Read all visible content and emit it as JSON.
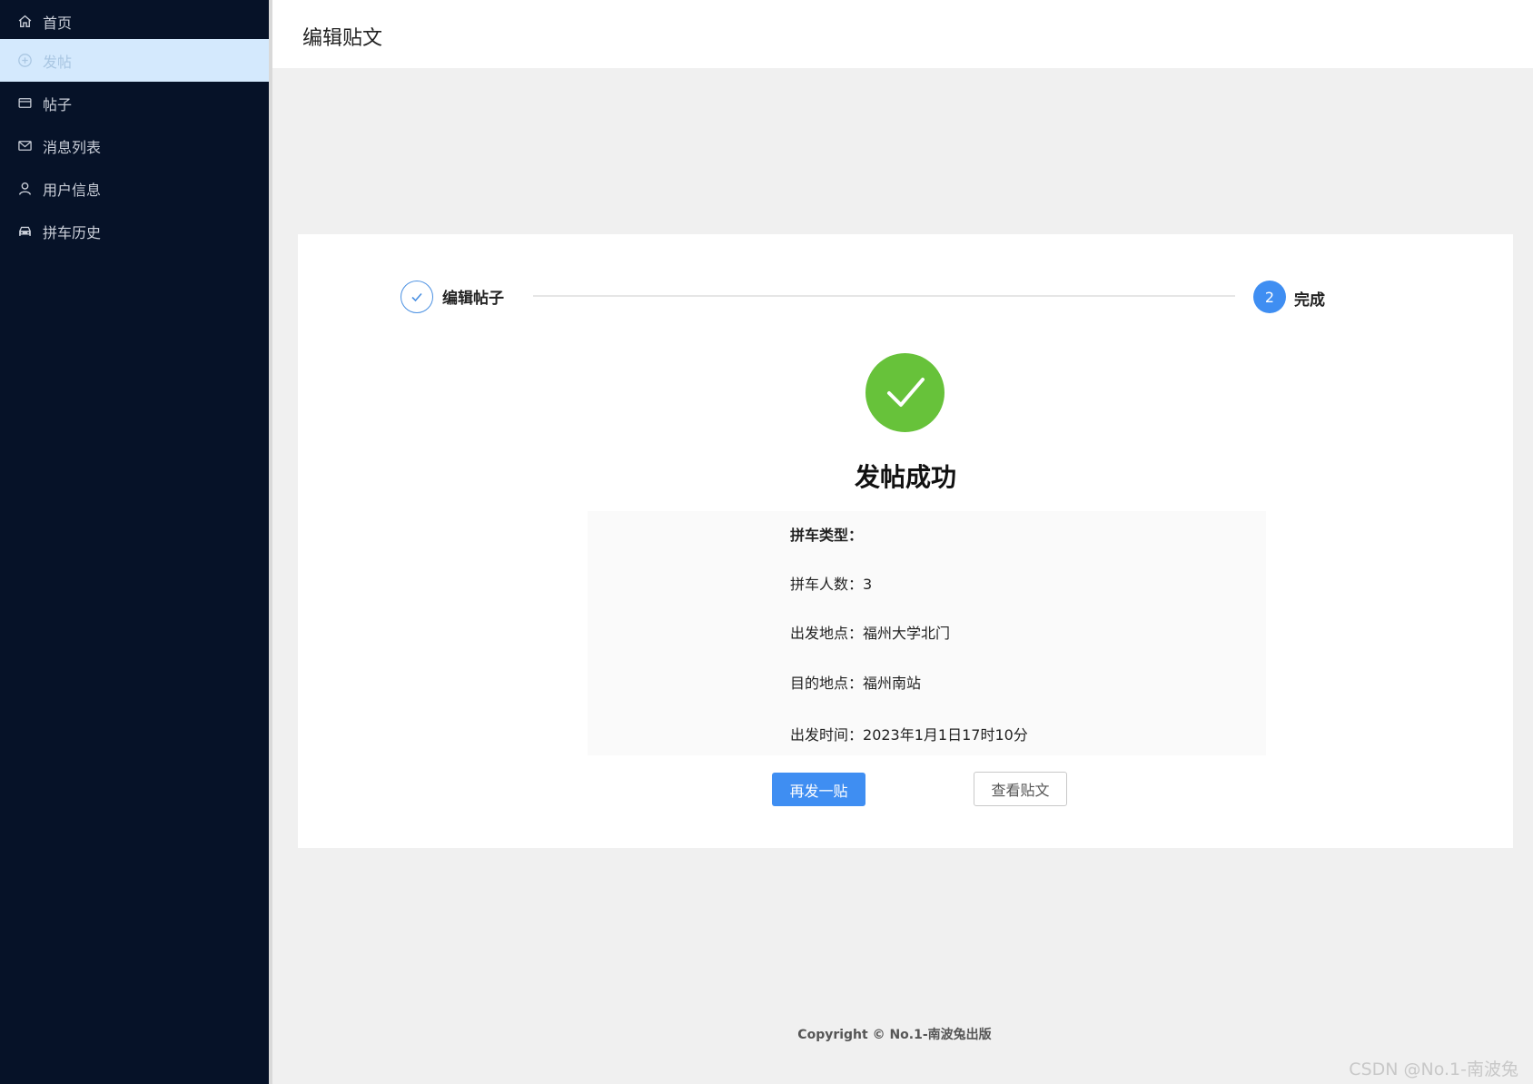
{
  "sidebar": {
    "items": [
      {
        "label": "首页",
        "icon": "home-icon"
      },
      {
        "label": "发帖",
        "icon": "plus-circle-icon",
        "active": true
      },
      {
        "label": "帖子",
        "icon": "card-icon"
      },
      {
        "label": "消息列表",
        "icon": "mail-icon"
      },
      {
        "label": "用户信息",
        "icon": "user-icon"
      },
      {
        "label": "拼车历史",
        "icon": "car-icon"
      }
    ]
  },
  "header": {
    "title": "编辑贴文"
  },
  "steps": [
    {
      "label": "编辑帖子",
      "status": "done"
    },
    {
      "label": "完成",
      "number": "2",
      "status": "active"
    }
  ],
  "result": {
    "title": "发帖成功",
    "fields": [
      {
        "key": "拼车类型：",
        "value": ""
      },
      {
        "key": "拼车人数：",
        "value": "3"
      },
      {
        "key": "出发地点：",
        "value": "福州大学北门"
      },
      {
        "key": "目的地点：",
        "value": "福州南站"
      },
      {
        "key": "出发时间：",
        "value": "2023年1月1日17时10分"
      }
    ]
  },
  "buttons": {
    "post_again": "再发一贴",
    "view_post": "查看贴文"
  },
  "footer": {
    "copyright": "Copyright © No.1-南波兔出版"
  },
  "watermark": "CSDN @No.1-南波兔",
  "colors": {
    "sidebar_bg": "#061228",
    "active_bg": "#d4e9fd",
    "primary": "#3f8ef2",
    "success": "#67c23a"
  }
}
